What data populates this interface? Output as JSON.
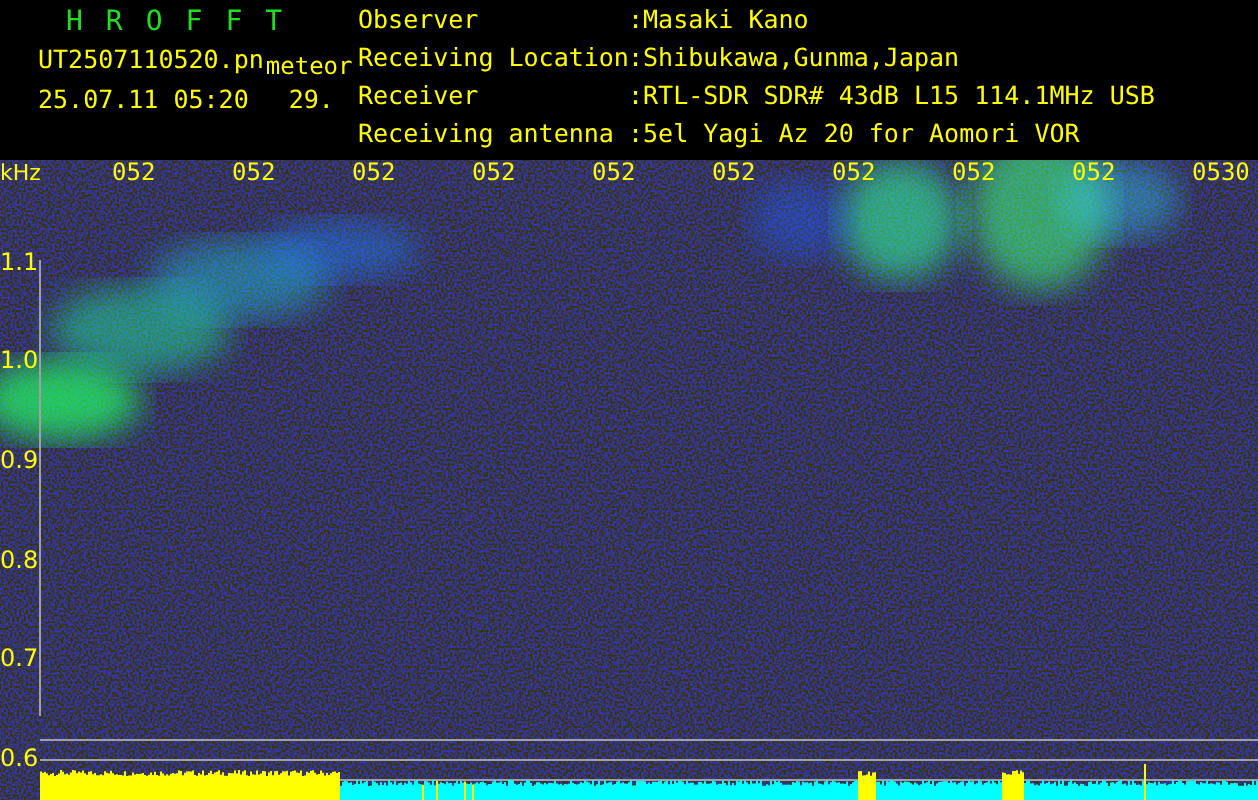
{
  "header": {
    "title": "HROFFT",
    "file": "UT2507110520.pn",
    "mode": "meteor",
    "datetime": "25.07.11 05:20",
    "count": "29."
  },
  "info": [
    {
      "label": "Observer",
      "value": ":Masaki Kano"
    },
    {
      "label": "Receiving Location",
      "value": ":Shibukawa,Gunma,Japan"
    },
    {
      "label": "Receiver",
      "value": ":RTL-SDR SDR# 43dB L15 114.1MHz USB"
    },
    {
      "label": "Receiving antenna",
      "value": ":5el Yagi Az 20 for Aomori VOR"
    }
  ],
  "plot": {
    "unit": "kHz",
    "time_labels": [
      "052",
      "052",
      "052",
      "052",
      "052",
      "052",
      "052",
      "052",
      "052",
      "0530"
    ],
    "freq_labels": [
      "1.1",
      "1.0",
      "0.9",
      "0.8",
      "0.7",
      "0.6"
    ]
  }
}
